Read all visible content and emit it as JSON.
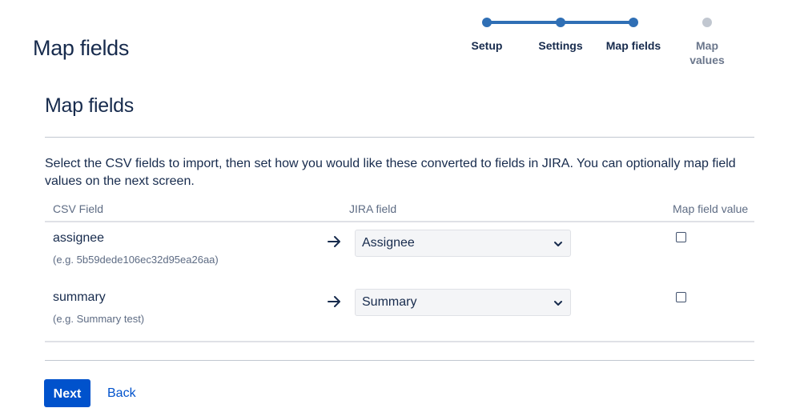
{
  "header": {
    "title": "Map fields"
  },
  "progress": {
    "steps": [
      {
        "label": "Setup",
        "state": "complete"
      },
      {
        "label": "Settings",
        "state": "complete"
      },
      {
        "label": "Map fields",
        "state": "current"
      },
      {
        "label": "Map values",
        "state": "upcoming"
      }
    ],
    "active_color": "#2f6fb5",
    "inactive_color": "#c1c7d0"
  },
  "section": {
    "title": "Map fields",
    "description": "Select the CSV fields to import, then set how you would like these converted to fields in JIRA. You can optionally map field values on the next screen."
  },
  "table": {
    "headers": {
      "csv_field": "CSV Field",
      "jira_field": "JIRA field",
      "map_value": "Map field value"
    },
    "rows": [
      {
        "csv_name": "assignee",
        "example": "(e.g.  5b59dede106ec32d95ea26aa)",
        "arrow_icon": "arrow-right-icon",
        "jira_field": "Assignee",
        "map_field_value": false
      },
      {
        "csv_name": "summary",
        "example": "(e.g.  Summary test)",
        "arrow_icon": "arrow-right-icon",
        "jira_field": "Summary",
        "map_field_value": false
      }
    ]
  },
  "actions": {
    "next_label": "Next",
    "back_label": "Back",
    "primary_color": "#0052cc"
  }
}
